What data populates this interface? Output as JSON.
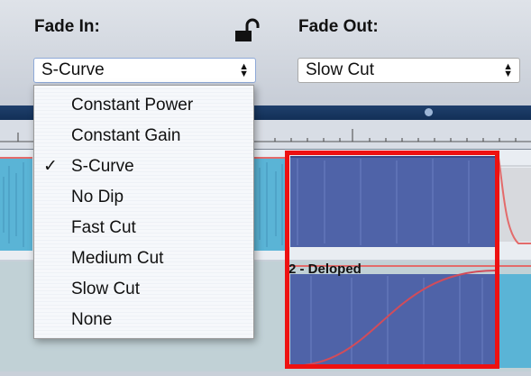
{
  "fade_in": {
    "label": "Fade In:",
    "selected": "S-Curve",
    "options": [
      "Constant Power",
      "Constant Gain",
      "S-Curve",
      "No Dip",
      "Fast Cut",
      "Medium Cut",
      "Slow Cut",
      "None"
    ],
    "checked_index": 2
  },
  "fade_out": {
    "label": "Fade Out:",
    "selected": "Slow Cut"
  },
  "clip": {
    "label": "2 - Deloped"
  },
  "icons": {
    "lock": "unlocked-padlock-icon",
    "check": "checkmark-icon",
    "select_arrows": "updown-arrows-icon"
  },
  "colors": {
    "highlight_box": "#ee1111",
    "waveform_blue": "#4f63a8",
    "waveform_cyan": "#5ab4d6"
  }
}
